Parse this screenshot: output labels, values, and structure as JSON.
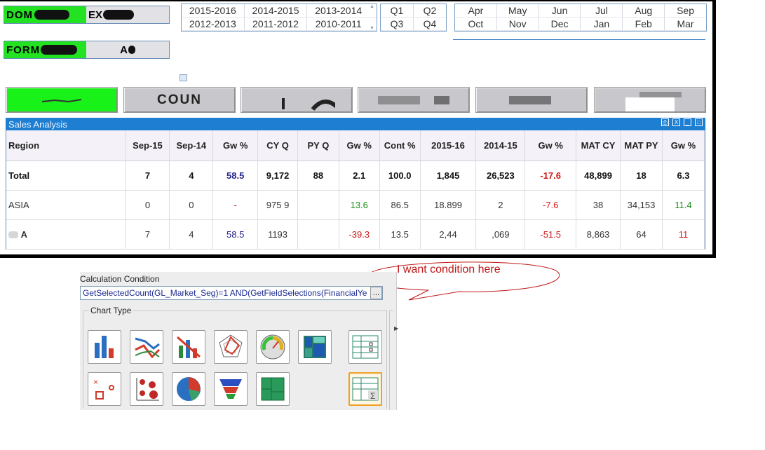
{
  "left_boxes": [
    {
      "label": "DOM",
      "value": "EX"
    },
    {
      "label": "FORM",
      "value": "A"
    }
  ],
  "years": {
    "row1": [
      "2015-2016",
      "2014-2015",
      "2013-2014"
    ],
    "row2": [
      "2012-2013",
      "2011-2012",
      "2010-2011"
    ]
  },
  "quarters": {
    "row1": [
      "Q1",
      "Q2"
    ],
    "row2": [
      "Q3",
      "Q4"
    ]
  },
  "months": {
    "row1": [
      "Apr",
      "May",
      "Jun",
      "Jul",
      "Aug",
      "Sep"
    ],
    "row2": [
      "Oct",
      "Nov",
      "Dec",
      "Jan",
      "Feb",
      "Mar"
    ]
  },
  "buttons": [
    "",
    "COUN",
    "",
    "",
    "",
    ""
  ],
  "sales": {
    "title": "Sales Analysis",
    "headers": [
      "Region",
      "Sep-15",
      "Sep-14",
      "Gw %",
      "CY Q",
      "PY Q",
      "Gw %",
      "Cont %",
      "2015-16",
      "2014-15",
      "Gw %",
      "MAT CY",
      "MAT PY",
      "Gw %"
    ],
    "rows": [
      {
        "cells": [
          "Total",
          "7",
          "4",
          "58.5",
          "9,172",
          "88",
          "2.1",
          "100.0",
          "1,845",
          "26,523",
          "-17.6",
          "48,899",
          "18",
          "6.3"
        ]
      },
      {
        "cells": [
          "ASIA",
          "0",
          "0",
          "-",
          "975 9",
          "",
          "13.6",
          "86.5",
          "18.899",
          "2",
          "-7.6",
          "38",
          "34,153",
          "11.4"
        ]
      },
      {
        "cells": [
          "A",
          "7",
          "4",
          "58.5",
          "1193",
          "",
          "-39.3",
          "13.5",
          "2,44",
          ",069",
          "-51.5",
          "8,863",
          "64",
          "11"
        ]
      }
    ]
  },
  "bubble": {
    "text": "I want condition here"
  },
  "dialog": {
    "label": "Calculation Condition",
    "condition": "GetSelectedCount(GL_Market_Seg)=1 AND(GetFieldSelections(FinancialYe",
    "ellipsis": "...",
    "group_label": "Chart Type",
    "chart_types": [
      "bar-chart-icon",
      "line-chart-icon",
      "combo-chart-icon",
      "radar-chart-icon",
      "gauge-chart-icon",
      "mekko-chart-icon",
      "pivot-table-icon",
      "scatter-chart-icon",
      "grid-chart-icon",
      "pie-chart-icon",
      "funnel-chart-icon",
      "block-chart-icon",
      "straight-table-icon"
    ]
  },
  "colors": {
    "selected_green": "#19f219",
    "title_blue": "#1e7fd2",
    "negative": "#d11818",
    "positive": "#1d8f1d"
  }
}
